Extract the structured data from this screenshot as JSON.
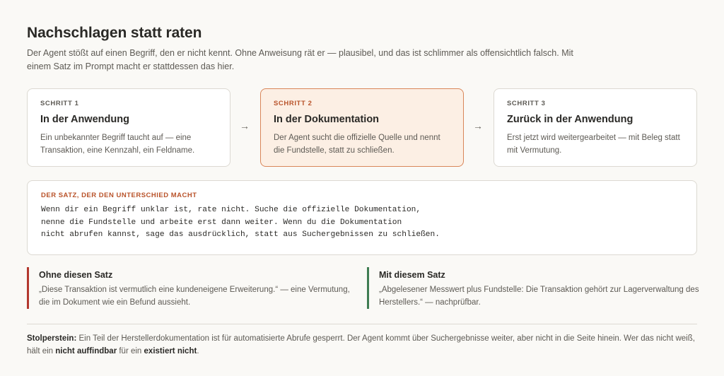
{
  "header": {
    "title": "Nachschlagen statt raten",
    "intro": "Der Agent stößt auf einen Begriff, den er nicht kennt. Ohne Anweisung rät er — plausibel, und das ist schlimmer als offensichtlich falsch. Mit einem Satz im Prompt macht er stattdessen das hier."
  },
  "steps": [
    {
      "label": "SCHRITT 1",
      "title": "In der Anwendung",
      "text": "Ein unbekannter Begriff taucht auf — eine Transaktion, eine Kennzahl, ein Feldname."
    },
    {
      "label": "SCHRITT 2",
      "title": "In der Dokumentation",
      "text": "Der Agent sucht die offizielle Quelle und nennt die Fundstelle, statt zu schließen."
    },
    {
      "label": "SCHRITT 3",
      "title": "Zurück in der Anwendung",
      "text": "Erst jetzt wird weitergearbeitet — mit Beleg statt mit Vermutung."
    }
  ],
  "arrows": [
    "→",
    "→"
  ],
  "satz": {
    "label": "DER SATZ, DER DEN UNTERSCHIED MACHT",
    "text": "Wenn dir ein Begriff unklar ist, rate nicht. Suche die offizielle Dokumentation,\nnenne die Fundstelle und arbeite erst dann weiter. Wenn du die Dokumentation\nnicht abrufen kannst, sage das ausdrücklich, statt aus Suchergebnissen zu schließen."
  },
  "compare": {
    "without": {
      "title": "Ohne diesen Satz",
      "text": "„Diese Transaktion ist vermutlich eine kundeneigene Erweiterung.“ — eine Vermutung, die im Dokument wie ein Befund aussieht."
    },
    "with": {
      "title": "Mit diesem Satz",
      "text": "„Abgelesener Messwert plus Fundstelle: Die Transaktion gehört zur Lagerverwaltung des Herstellers.“ — nachprüfbar."
    }
  },
  "stolperstein": {
    "label": "Stolperstein:",
    "text1": " Ein Teil der Herstellerdokumentation ist für automatisierte Abrufe gesperrt. Der Agent kommt über Suchergebnisse weiter, aber nicht in die Seite hinein. Wer das nicht weiß, hält ein ",
    "em1": "nicht auffindbar",
    "text2": " für ein ",
    "em2": "existiert nicht",
    "text3": "."
  },
  "colors": {
    "accent": "#b9532a",
    "highlight_bg": "#fcefe4",
    "without_border": "#b3382e",
    "with_border": "#3f7d52"
  }
}
